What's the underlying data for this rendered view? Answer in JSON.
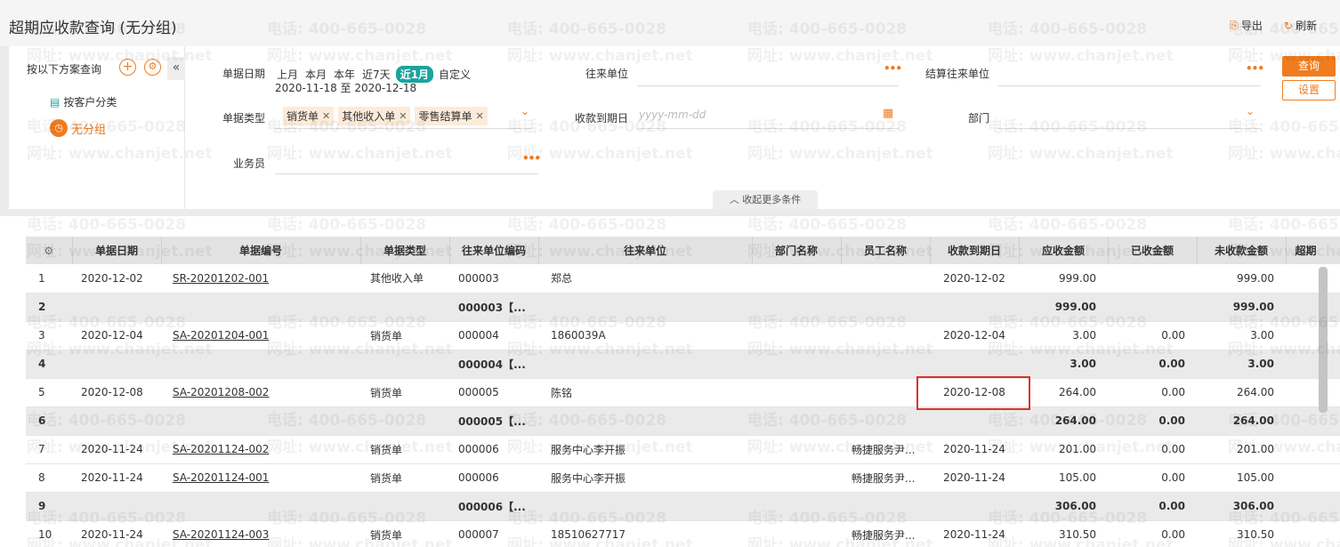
{
  "header": {
    "title": "超期应收款查询 (无分组)",
    "export_label": "导出",
    "refresh_label": "刷新"
  },
  "sidebar": {
    "scheme_label": "按以下方案查询",
    "add_icon": "plus-icon",
    "gear_icon": "gear-icon",
    "collapse_icon": "double-chevron-left-icon",
    "groups": [
      {
        "label": "按客户分类",
        "active": false
      },
      {
        "label": "无分组",
        "active": true
      }
    ]
  },
  "filters": {
    "doc_date_label": "单据日期",
    "quick_ranges": [
      "上月",
      "本月",
      "本年",
      "近7天",
      "近1月",
      "自定义"
    ],
    "selected_range": "近1月",
    "date_range_value": "2020-11-18 至 2020-12-18",
    "doc_type_label": "单据类型",
    "doc_types": [
      "销货单",
      "其他收入单",
      "零售结算单"
    ],
    "salesman_label": "业务员",
    "partner_label": "往来单位",
    "due_label": "收款到期日",
    "due_placeholder": "yyyy-mm-dd",
    "settle_partner_label": "结算往来单位",
    "dept_label": "部门",
    "query_button": "查询",
    "settings_button": "设置",
    "more_conditions": "收起更多条件"
  },
  "table": {
    "columns": [
      "单据日期",
      "单据编号",
      "单据类型",
      "往来单位编码",
      "往来单位",
      "部门名称",
      "员工名称",
      "收款到期日",
      "应收金额",
      "已收金额",
      "未收款金额",
      "超期"
    ],
    "rows": [
      {
        "seq": "1",
        "date": "2020-12-02",
        "no": "SR-20201202-001",
        "type": "其他收入单",
        "code": "000003",
        "name": "郑总",
        "dept": "",
        "emp": "",
        "due": "2020-12-02",
        "receivable": "999.00",
        "received": "",
        "unreceived": "999.00",
        "subtotal": false
      },
      {
        "seq": "2",
        "date": "",
        "no": "",
        "type": "",
        "code": "000003【...",
        "name": "",
        "dept": "",
        "emp": "",
        "due": "",
        "receivable": "999.00",
        "received": "",
        "unreceived": "999.00",
        "subtotal": true
      },
      {
        "seq": "3",
        "date": "2020-12-04",
        "no": "SA-20201204-001",
        "type": "销货单",
        "code": "000004",
        "name": "1860039A",
        "dept": "",
        "emp": "",
        "due": "2020-12-04",
        "receivable": "3.00",
        "received": "0.00",
        "unreceived": "3.00",
        "subtotal": false
      },
      {
        "seq": "4",
        "date": "",
        "no": "",
        "type": "",
        "code": "000004【...",
        "name": "",
        "dept": "",
        "emp": "",
        "due": "",
        "receivable": "3.00",
        "received": "0.00",
        "unreceived": "3.00",
        "subtotal": true
      },
      {
        "seq": "5",
        "date": "2020-12-08",
        "no": "SA-20201208-002",
        "type": "销货单",
        "code": "000005",
        "name": "陈铭",
        "dept": "",
        "emp": "",
        "due": "2020-12-08",
        "receivable": "264.00",
        "received": "0.00",
        "unreceived": "264.00",
        "subtotal": false
      },
      {
        "seq": "6",
        "date": "",
        "no": "",
        "type": "",
        "code": "000005【...",
        "name": "",
        "dept": "",
        "emp": "",
        "due": "",
        "receivable": "264.00",
        "received": "0.00",
        "unreceived": "264.00",
        "subtotal": true
      },
      {
        "seq": "7",
        "date": "2020-11-24",
        "no": "SA-20201124-002",
        "type": "销货单",
        "code": "000006",
        "name": "服务中心李开振",
        "dept": "",
        "emp": "畅捷服务尹...",
        "due": "2020-11-24",
        "receivable": "201.00",
        "received": "0.00",
        "unreceived": "201.00",
        "subtotal": false
      },
      {
        "seq": "8",
        "date": "2020-11-24",
        "no": "SA-20201124-001",
        "type": "销货单",
        "code": "000006",
        "name": "服务中心李开振",
        "dept": "",
        "emp": "畅捷服务尹...",
        "due": "2020-11-24",
        "receivable": "105.00",
        "received": "0.00",
        "unreceived": "105.00",
        "subtotal": false
      },
      {
        "seq": "9",
        "date": "",
        "no": "",
        "type": "",
        "code": "000006【...",
        "name": "",
        "dept": "",
        "emp": "",
        "due": "",
        "receivable": "306.00",
        "received": "0.00",
        "unreceived": "306.00",
        "subtotal": true
      },
      {
        "seq": "10",
        "date": "2020-11-24",
        "no": "SA-20201124-003",
        "type": "销货单",
        "code": "000007",
        "name": "18510627717",
        "dept": "",
        "emp": "畅捷服务尹...",
        "due": "2020-11-24",
        "receivable": "310.50",
        "received": "0.00",
        "unreceived": "310.50",
        "subtotal": false
      }
    ]
  },
  "watermark": {
    "phone": "电话: 400-665-0028",
    "site": "网址: www.chanjet.net"
  },
  "colors": {
    "accent": "#f07c1e",
    "teal": "#1ba39c",
    "highlight": "#d9322a"
  }
}
